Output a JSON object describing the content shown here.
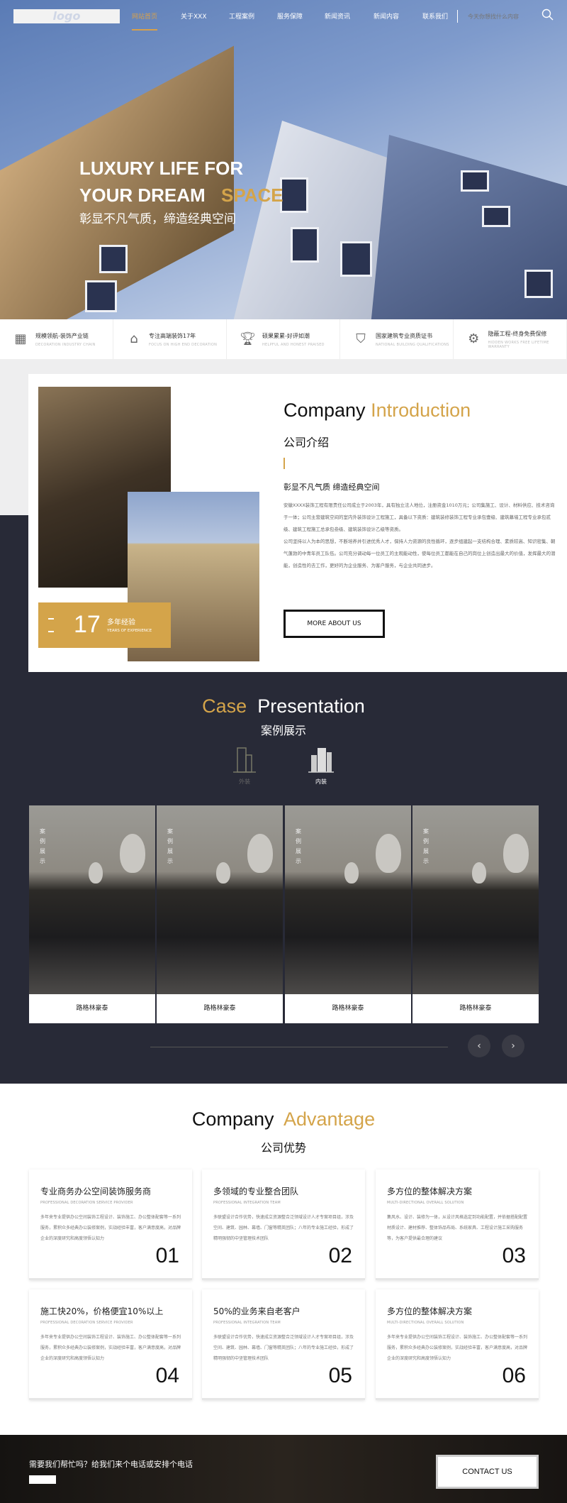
{
  "nav": {
    "logo": "logo",
    "items": [
      "网站首页",
      "关于XXX",
      "工程案例",
      "服务保障",
      "新闻资讯",
      "新闻内容",
      "联系我们"
    ],
    "search_placeholder": "今天你想找什么内容"
  },
  "hero": {
    "line1": "LUXURY LIFE FOR",
    "line2": "YOUR DREAM",
    "highlight": "SPACE",
    "subtitle": "彰显不凡气质，缔造经典空间"
  },
  "features": [
    {
      "icon": "building-chain-icon",
      "title": "规模领航-装饰产业链",
      "en": "DECORATION INDUSTRY CHAIN"
    },
    {
      "icon": "house-icon",
      "title": "专注高端装饰17年",
      "en": "FOCUS ON HIGH END DECORATION"
    },
    {
      "icon": "trophy-icon",
      "title": "硕果累累-好评如潮",
      "en": "HELPFUL AND HONEST PRAISED"
    },
    {
      "icon": "badge-icon",
      "title": "国家建筑专业资质证书",
      "en": "NATIONAL BUILDING QUALIFICATIONS"
    },
    {
      "icon": "hand-gear-icon",
      "title": "隐蔽工程-终身免费保修",
      "en": "HIDDEN WORKS FREE LIFETIME WARRANTY"
    }
  ],
  "intro": {
    "title_a": "Company",
    "title_b": "Introduction",
    "title_cn": "公司介绍",
    "subtitle": "彰显不凡气质 缔造经典空间",
    "p1": "安徽XXXX装饰工程有限责任公司成立于2003年，具有独立法人地位，注册资金1010万元；公司集施工、设计、材料供应、技术咨询于一体；公司主营建筑空间的室内外装饰设计工程施工，具备以下资质：建筑装修装饰工程专业承包壹级、建筑幕墙工程专业承包贰级、建筑工程施工总承包叁级、建筑装饰设计乙级等资质。",
    "p2": "公司坚持以人为本的思想，不断培养并引进优秀人才，保持人力资源的良性循环，逐步组建起一支结构合理、素质较高、知识密集、朝气蓬勃的中青年员工队伍。公司充分调动每一位员工的主观能动性，使每位员工都能在自己的岗位上创造出最大的价值，发挥最大的潜能，创造性的去工作，更好的为企业服务、为客户服务，与企业共同进步。",
    "years": "17",
    "years_cn": "多年经验",
    "years_en": "YEARS OF EXPERIENCE",
    "button": "MORE ABOUT US"
  },
  "cases": {
    "title_a": "Case",
    "title_b": "Presentation",
    "title_cn": "案例展示",
    "tabs": [
      {
        "label": "外装",
        "icon": "building-outline-icon",
        "active": false
      },
      {
        "label": "内装",
        "icon": "building-solid-icon",
        "active": true
      }
    ],
    "items": [
      {
        "tag": "案例展示",
        "caption": "路格林豪泰"
      },
      {
        "tag": "案例展示",
        "caption": "路格林豪泰"
      },
      {
        "tag": "案例展示",
        "caption": "路格林豪泰"
      },
      {
        "tag": "案例展示",
        "caption": "路格林豪泰"
      }
    ]
  },
  "advantage": {
    "title_a": "Company",
    "title_b": "Advantage",
    "title_cn": "公司优势",
    "items": [
      {
        "title": "专业商务办公空间装饰服务商",
        "en": "PROFESSIONAL DECORATION SERVICE PROVIDER",
        "desc": "多年来专业提供办公空间装饰工程设计、装饰施工、办公整体配套等一系列服务，累积众多经典办公装修案例，实战经验丰富，客户满意度高，对品牌企业的深度研究和高度领悟认知力",
        "num": "01"
      },
      {
        "title": "多领域的专业整合团队",
        "en": "PROFESSIONAL INTEGRATION TEAM",
        "desc": "多联盟设计合作优势，快速成立资源整合泛领域设计人才专案项目组，涉及空间、建筑、园林、幕墙、门窗等精英团队；八年的专业施工经验，形成了精明强韧的中坚管理技术团队",
        "num": "02"
      },
      {
        "title": "多方位的整体解决方案",
        "en": "MULTI-DIRECTIONAL OVERALL SOLUTION",
        "desc": "集风水、设计、装修为一体，从设计风格选定到功能配置，并依据搭配配置材质设计、建材推荐、整体饰品布局、系统家具、工程设计施工采购服务等，为客户提供最合理的建议",
        "num": "03"
      },
      {
        "title": "施工快20%，价格便宜10%以上",
        "en": "PROFESSIONAL DECORATION SERVICE PROVIDER",
        "desc": "多年来专业提供办公空间装饰工程设计、装饰施工、办公整体配套等一系列服务，累积众多经典办公装修案例，实战经验丰富，客户满意度高，对品牌企业的深度研究和高度领悟认知力",
        "num": "04"
      },
      {
        "title": "50%的业务来自老客户",
        "en": "PROFESSIONAL INTEGRATION TEAM",
        "desc": "多联盟设计合作优势，快速成立资源整合泛领域设计人才专案项目组，涉及空间、建筑、园林、幕墙、门窗等精英团队；八年的专业施工经验，形成了精明强韧的中坚管理技术团队",
        "num": "05"
      },
      {
        "title": "多方位的整体解决方案",
        "en": "MULTI-DIRECTIONAL OVERALL SOLUTION",
        "desc": "多年来专业提供办公空间装饰工程设计、装饰施工、办公整体配套等一系列服务，累积众多经典办公装修案例，实战经验丰富，客户满意度高，对品牌企业的深度研究和高度领悟认知力",
        "num": "06"
      }
    ]
  },
  "footer": {
    "text": "需要我们帮忙吗？给我们来个电话或安排个电话",
    "button": "CONTACT US"
  },
  "colors": {
    "accent": "#d4a44a",
    "dark": "#282a37"
  }
}
